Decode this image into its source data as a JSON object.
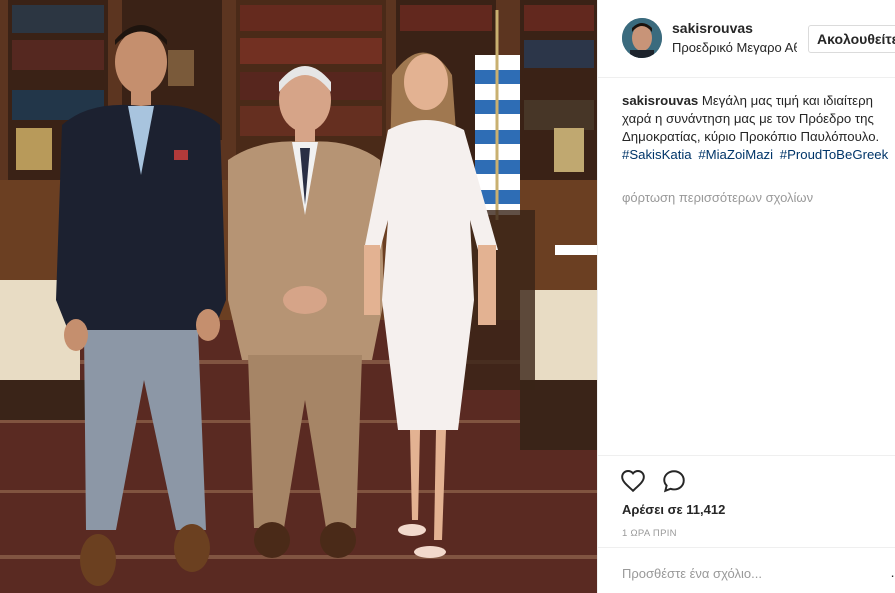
{
  "post": {
    "username": "sakisrouvas",
    "location": "Προεδρικό Μεγαρο Αθηνών",
    "follow_label": "Ακολουθείτε"
  },
  "caption": {
    "username": "sakisrouvas",
    "text": "Μεγάλη μας τιμή και ιδιαίτερη χαρά η συνάντηση μας με τον Πρόεδρο της Δημοκρατίας, κύριο Προκόπιο Παυλόπουλο.",
    "hashtags": [
      "#SakisKatia",
      "#MiaZoiMazi",
      "#ProudToBeGreek"
    ]
  },
  "comments": {
    "load_more_label": "φόρτωση περισσότερων σχολίων"
  },
  "engagement": {
    "likes_label": "Αρέσει σε 11,412",
    "time_label": "1 ΩΡΑ ΠΡΙΝ"
  },
  "composer": {
    "placeholder": "Προσθέστε ένα σχόλιο..."
  },
  "icons": {
    "like": "heart-icon",
    "comment": "comment-icon",
    "more": "more-options-icon"
  },
  "colors": {
    "hashtag": "#003569",
    "muted": "#999999",
    "text": "#262626",
    "border": "#efefef"
  }
}
